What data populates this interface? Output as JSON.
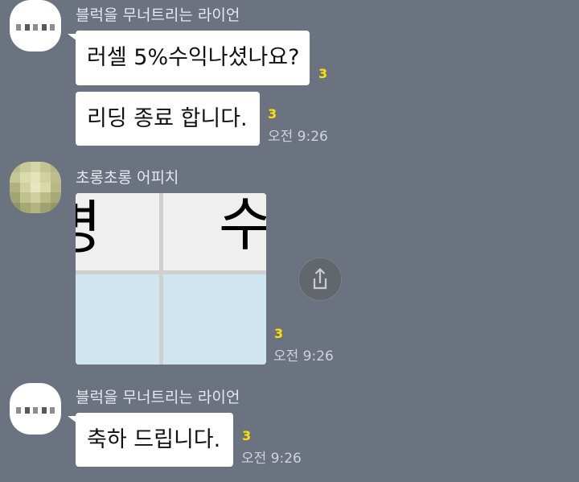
{
  "messages": [
    {
      "sender": "블럭을 무너트리는 라이언",
      "avatar_icon": "profile-icon",
      "bubbles": [
        {
          "text": "러셀 5%수익나셨나요?",
          "unread": "3"
        },
        {
          "text": "리딩 종료 합니다.",
          "unread": "3",
          "time": "오전 9:26"
        }
      ]
    },
    {
      "sender": "초롱초롱 어피치",
      "avatar_icon": "blurred-profile-photo",
      "image": {
        "left_glyph": "명",
        "right_glyph": "수",
        "colors": {
          "top": "#efefef",
          "bottom": "#cfe6f0",
          "divider": "#cfcfcf"
        }
      },
      "share_icon": "share-icon",
      "unread": "3",
      "time": "오전 9:26"
    },
    {
      "sender": "블럭을 무너트리는 라이언",
      "avatar_icon": "profile-icon",
      "bubbles": [
        {
          "text": "축하 드립니다.",
          "unread": "3",
          "time": "오전 9:26"
        }
      ]
    }
  ],
  "colors": {
    "background": "#6b7380",
    "bubble": "#ffffff",
    "unread": "#ffe100",
    "time": "#cfd3da"
  }
}
